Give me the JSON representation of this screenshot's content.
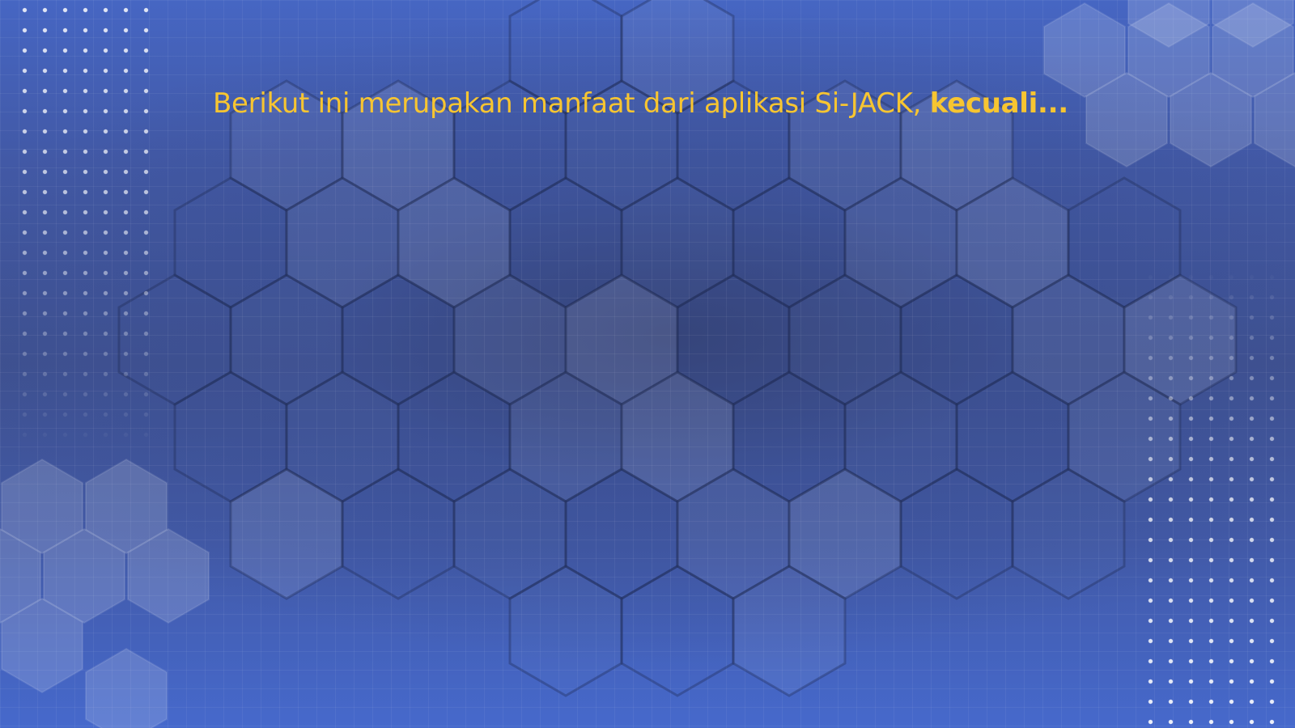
{
  "slide": {
    "question": {
      "text": "Berikut ini merupakan manfaat dari aplikasi Si-JACK, ",
      "emphasis": "kecuali..."
    }
  },
  "theme": {
    "background": "#4259a6",
    "text_color": "#f7c531"
  }
}
